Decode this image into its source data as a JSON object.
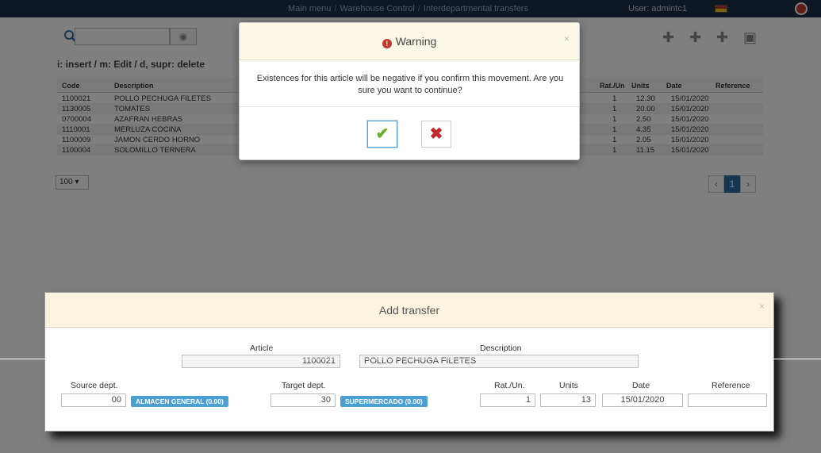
{
  "nav": {
    "crumbs": [
      "Main menu",
      "Warehouse Control",
      "Interdepartmental transfers"
    ],
    "user": "User: admintc1"
  },
  "toolbar": {
    "hint": "i: insert / m: Edit / d, supr: delete"
  },
  "table": {
    "headers": [
      "Code",
      "Description",
      "Rat./Un",
      "Units",
      "Date",
      "Reference"
    ],
    "rows": [
      {
        "code": "1100021",
        "description": "POLLO PECHUGA FILETES",
        "rat": "1",
        "units": "12.30",
        "date": "15/01/2020",
        "reference": ""
      },
      {
        "code": "1130005",
        "description": "TOMATES",
        "rat": "1",
        "units": "20.00",
        "date": "15/01/2020",
        "reference": ""
      },
      {
        "code": "0700004",
        "description": "AZAFRAN HEBRAS",
        "rat": "1",
        "units": "2.50",
        "date": "15/01/2020",
        "reference": ""
      },
      {
        "code": "1110001",
        "description": "MERLUZA COCINA",
        "rat": "1",
        "units": "4.35",
        "date": "15/01/2020",
        "reference": ""
      },
      {
        "code": "1100009",
        "description": "JAMON CERDO HORNO",
        "rat": "1",
        "units": "2.05",
        "date": "15/01/2020",
        "reference": ""
      },
      {
        "code": "1100004",
        "description": "SOLOMILLO TERNERA",
        "rat": "1",
        "units": "11.15",
        "date": "15/01/2020",
        "reference": ""
      }
    ],
    "page_size": "100",
    "current_page": "1"
  },
  "transfer": {
    "title": "Add transfer",
    "article_label": "Article",
    "article_value": "1100021",
    "description_label": "Description",
    "description_value": "POLLO PECHUGA FILETES",
    "source_label": "Source dept.",
    "source_value": "00",
    "source_badge": "ALMACEN GENERAL (0.00)",
    "target_label": "Target dept.",
    "target_value": "30",
    "target_badge": "SUPERMERCADO (0.00)",
    "rat_label": "Rat./Un.",
    "rat_value": "1",
    "units_label": "Units",
    "units_value": "13",
    "date_label": "Date",
    "date_value": "15/01/2020",
    "reference_label": "Reference",
    "reference_value": ""
  },
  "warning": {
    "title": "Warning",
    "message": "Existences for this article will be negative if you confirm this movement. Are you sure you want to continue?"
  },
  "colors": {
    "nav_bg": "#1f2f47",
    "badge": "#4a9fd4",
    "confirm": "#6aae2a",
    "cancel": "#c0282b",
    "dialog_header": "#fbf3df"
  }
}
